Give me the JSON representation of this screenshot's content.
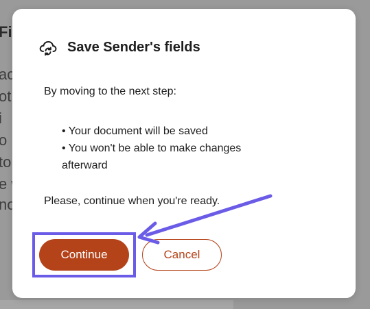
{
  "background": {
    "heading_fragment": "Fi",
    "text_fragments": [
      "ac",
      "ot",
      "i",
      "o",
      "to",
      "e w",
      "no"
    ]
  },
  "modal": {
    "icon": "cloud-sync-icon",
    "title": "Save Sender's fields",
    "intro": "By moving to the next step:",
    "bullets": [
      "• Your document will be saved",
      "• You won't be able to make changes afterward"
    ],
    "outro": "Please, continue when you're ready.",
    "continue_label": "Continue",
    "cancel_label": "Cancel"
  },
  "colors": {
    "accent": "#b5431a",
    "annotation": "#6b5ce7",
    "overlay": "#9a9a9a"
  }
}
